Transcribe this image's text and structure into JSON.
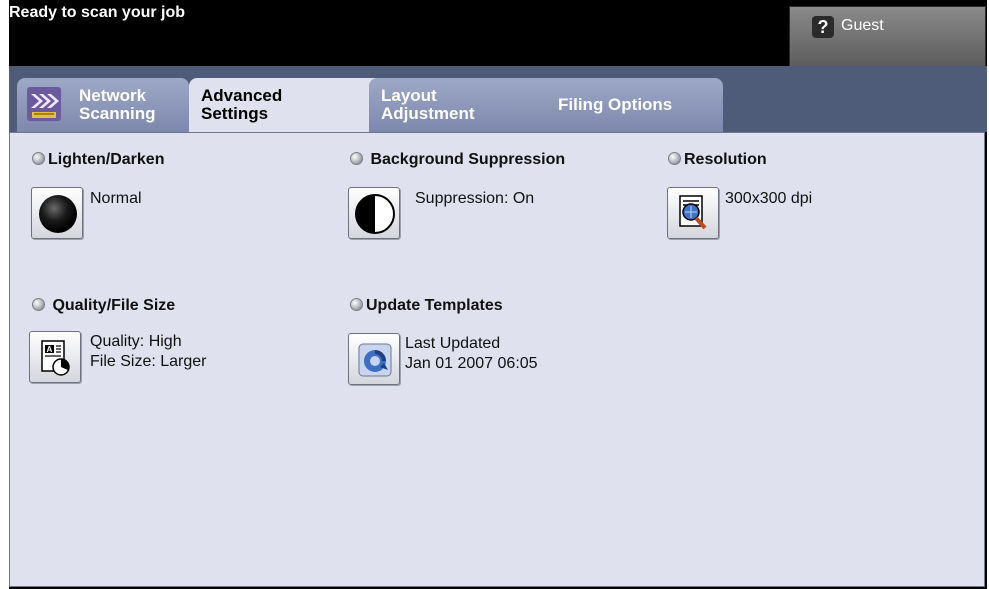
{
  "status_bar": {
    "message": "Ready to scan your job",
    "user_button_label": "Guest"
  },
  "tabs": [
    {
      "label": "Network\nScanning",
      "active": false,
      "icon": "network-scanning-icon"
    },
    {
      "label": "Advanced\nSettings",
      "active": true
    },
    {
      "label": "Layout\nAdjustment",
      "active": false
    },
    {
      "label": "Filing Options",
      "active": false
    }
  ],
  "features": {
    "lighten_darken": {
      "title": "Lighten/Darken",
      "value": "Normal",
      "icon": "lighten-darken-icon"
    },
    "background_suppression": {
      "title": "Background Suppression",
      "value": "Suppression: On",
      "icon": "half-circle-icon"
    },
    "resolution": {
      "title": "Resolution",
      "value": "300x300 dpi",
      "icon": "magnifier-document-icon"
    },
    "quality_file_size": {
      "title": "Quality/File Size",
      "value_line1": "Quality: High",
      "value_line2": "File Size: Larger",
      "icon": "document-quality-icon"
    },
    "update_templates": {
      "title": "Update Templates",
      "value_line1": "Last Updated",
      "value_line2": "Jan 01 2007 06:05",
      "icon": "refresh-icon"
    }
  },
  "colors": {
    "tab_bar": "#4e5b79",
    "panel": "#dfe1ef",
    "header": "#000000"
  }
}
